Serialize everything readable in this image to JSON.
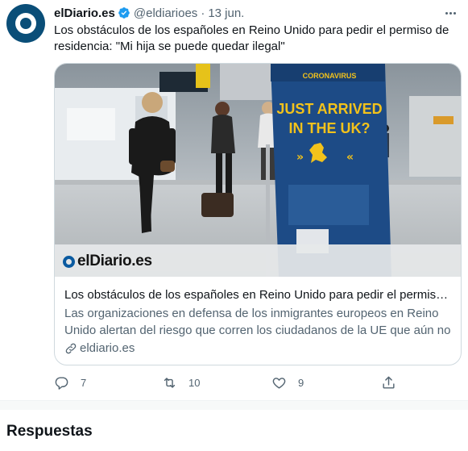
{
  "tweet": {
    "name": "elDiario.es",
    "handle": "@eldiarioes",
    "separator": "·",
    "date": "13 jun.",
    "text": "Los obstáculos de los españoles en Reino Unido para pedir el permiso de residencia: \"Mi hija se puede quedar ilegal\""
  },
  "card": {
    "image_logo": "elDiario.es",
    "sign": {
      "label": "CORONAVIRUS",
      "line1": "JUST ARRIVED",
      "line2": "IN THE UK?"
    },
    "title": "Los obstáculos de los españoles en Reino Unido para pedir el permiso de residencia",
    "description": "Las organizaciones en defensa de los inmigrantes europeos en Reino Unido alertan del riesgo que corren los ciudadanos de la UE que aún no han solicitado el estatus",
    "domain": "eldiario.es"
  },
  "actions": {
    "reply_count": "7",
    "retweet_count": "10",
    "like_count": "9"
  },
  "section_title": "Respuestas",
  "colors": {
    "accent": "#1d9bf0",
    "brand": "#0a4e78",
    "text_secondary": "#536471"
  }
}
